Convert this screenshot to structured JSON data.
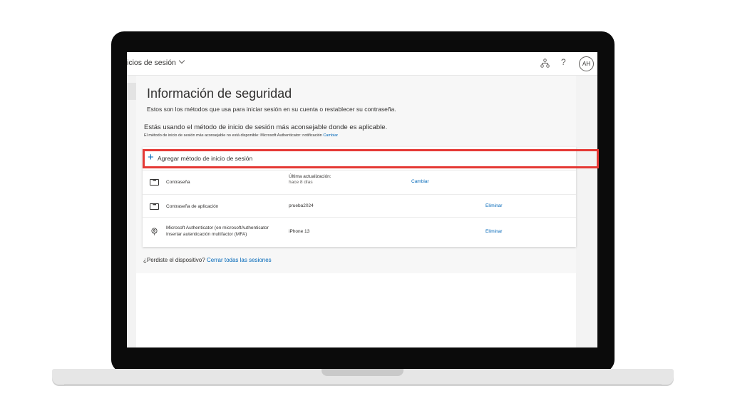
{
  "header": {
    "breadcrumb": "icios de sesión",
    "avatar_initials": "AH",
    "help_glyph": "?",
    "icons": [
      "organization-icon",
      "help-icon"
    ]
  },
  "page": {
    "title": "Información de seguridad",
    "description": "Estos son los métodos que usa para iniciar sesión en su cuenta o restablecer su contraseña."
  },
  "recommendation": {
    "main": "Estás usando el método de inicio de sesión más aconsejable donde es aplicable.",
    "sub_text": "El método de inicio de sesión más aconsejable no está disponible: Microsoft Authenticator: notificación",
    "sub_link": "Cambiar"
  },
  "add_method": {
    "plus": "+",
    "label": "Agregar método de inicio de sesión"
  },
  "methods": [
    {
      "icon": "password-dots-icon",
      "name": "Contraseña",
      "detail": "Última actualización:",
      "detail_sub": "hace 8 días",
      "action": "Cambiar"
    },
    {
      "icon": "password-dots-icon",
      "name": "Contraseña de aplicación",
      "detail": "prueba2024",
      "action": "Eliminar"
    },
    {
      "icon": "authenticator-icon",
      "name_line1": "Microsoft Authenticator (en microsoftAuthenticator",
      "name_line2": "Insertar autenticación multifactor (MFA)",
      "detail": "iPhone 13",
      "action": "Eliminar"
    }
  ],
  "lost_device": {
    "question": "¿Perdiste el dispositivo?",
    "link": "Cerrar todas las sesiones"
  },
  "colors": {
    "link": "#0067b8",
    "highlight": "#e53935",
    "text": "#323130"
  }
}
